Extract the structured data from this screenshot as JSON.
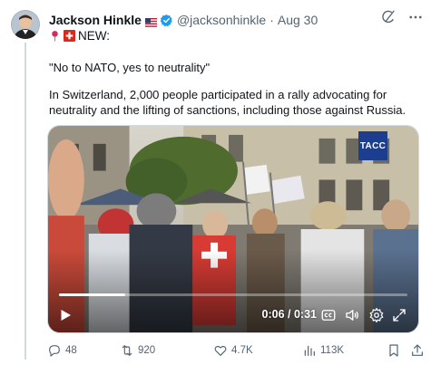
{
  "author": {
    "name": "Jackson Hinkle",
    "handle": "@jacksonhinkle",
    "date": "Aug 30",
    "flag_icon": "us-flag-icon",
    "verified_icon": "verified-badge-icon"
  },
  "tweet": {
    "prefix_icons": [
      "pin-icon",
      "swiss-flag-icon"
    ],
    "new_label": "NEW:",
    "quote": "\"No to NATO, yes to neutrality\"",
    "body": "In Switzerland, 2,000 people participated in a rally advocating for neutrality and the lifting of sanctions, including those against Russia."
  },
  "video": {
    "watermark": "TACC",
    "time_display": "0:06 / 0:31",
    "progress_fraction": 0.19
  },
  "actions": {
    "replies": "48",
    "reposts": "920",
    "likes": "4.7K",
    "views": "113K"
  },
  "colors": {
    "text_primary": "#0f1419",
    "text_secondary": "#536471",
    "verified_blue": "#1d9bf0",
    "tass_blue": "#1d3d8f"
  }
}
